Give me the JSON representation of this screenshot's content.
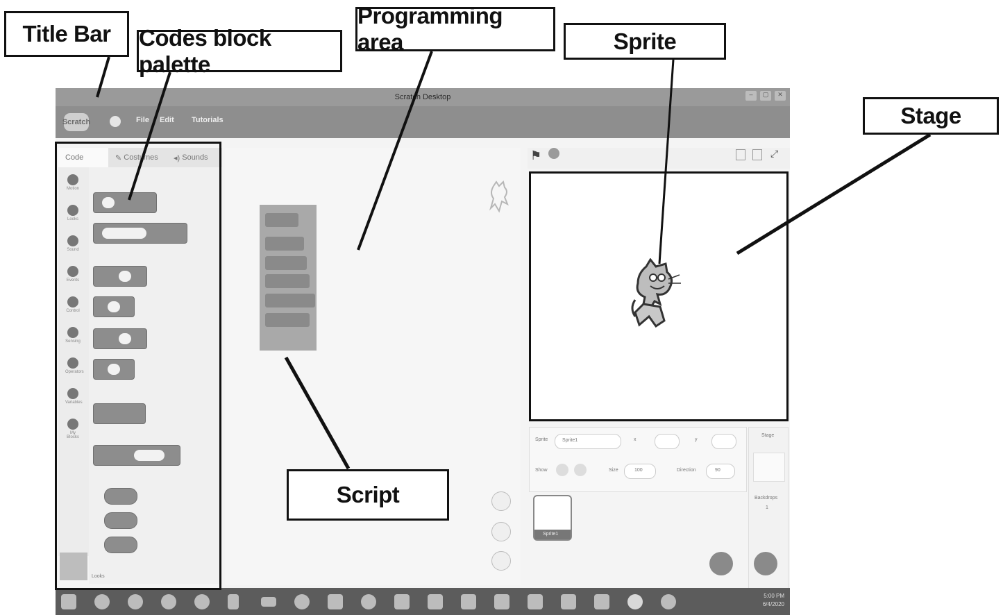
{
  "callouts": {
    "title_bar": "Title Bar",
    "codes_block_palette": "Codes block palette",
    "programming_area": "Programming area",
    "sprite": "Sprite",
    "stage": "Stage",
    "script": "Script"
  },
  "window": {
    "title": "Scratch Desktop",
    "logo": "Scratch",
    "menu": [
      "File",
      "Edit",
      "Tutorials"
    ]
  },
  "tabs": [
    "Code",
    "Costumes",
    "Sounds"
  ],
  "categories": [
    "Motion",
    "Looks",
    "Sound",
    "Events",
    "Control",
    "Sensing",
    "Operators",
    "Variables",
    "My Blocks"
  ],
  "palette_footer": "Looks",
  "sprite_info": {
    "sprite_label": "Sprite",
    "sprite_name": "Sprite1",
    "x_label": "x",
    "y_label": "y",
    "show_label": "Show",
    "size_label": "Size",
    "size_value": "100",
    "direction_label": "Direction",
    "direction_value": "90"
  },
  "sprite_tile_label": "Sprite1",
  "backdrop": {
    "stage_label": "Stage",
    "backdrops_label": "Backdrops",
    "count": "1"
  },
  "taskbar_clock": [
    "5:00 PM",
    "6/4/2020"
  ],
  "colors": {
    "annotation": "#111111",
    "window_gray": "#8e8e8e"
  }
}
